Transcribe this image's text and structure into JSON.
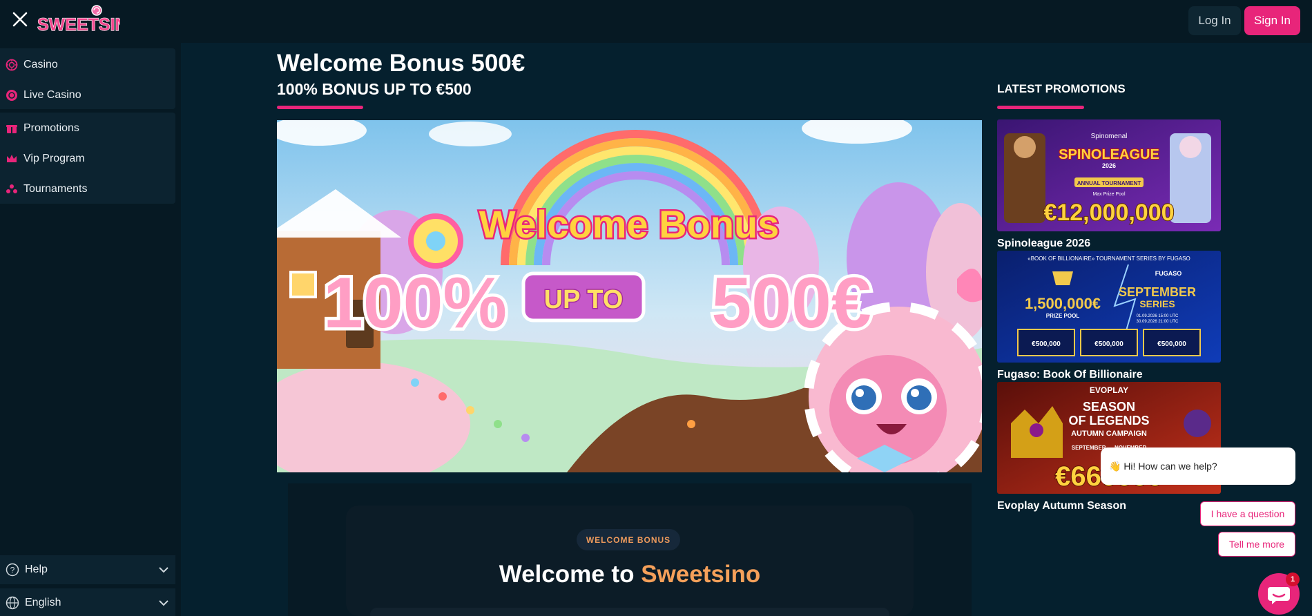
{
  "header": {
    "logo_text": "SWEETSINO",
    "login_label": "Log In",
    "signin_label": "Sign In"
  },
  "sidebar": {
    "items": [
      {
        "label": "Casino",
        "icon": "casino-chip-icon"
      },
      {
        "label": "Live Casino",
        "icon": "live-casino-icon"
      },
      {
        "label": "Promotions",
        "icon": "gift-icon"
      },
      {
        "label": "Vip Program",
        "icon": "crown-icon"
      },
      {
        "label": "Tournaments",
        "icon": "tournament-icon"
      }
    ],
    "help_label": "Help",
    "language_label": "English"
  },
  "main": {
    "title": "Welcome Bonus 500€",
    "subtitle": "100% BONUS UP TO €500",
    "banner": {
      "headline": "Welcome Bonus",
      "percent": "100%",
      "upto": "UP TO",
      "amount": "500€"
    },
    "card": {
      "badge": "WELCOME BONUS",
      "heading_prefix": "Welcome to",
      "heading_brand": "Sweetsino"
    }
  },
  "promotions": {
    "heading": "LATEST PROMOTIONS",
    "items": [
      {
        "name": "Spinoleague 2026",
        "img_brand": "Spinomenal",
        "img_title": "SPINOLEAGUE",
        "img_year": "2026",
        "img_sub": "ANNUAL TOURNAMENT",
        "img_note": "Max Prize Pool",
        "img_amount": "€12,000,000"
      },
      {
        "name": "Fugaso: Book Of Billionaire",
        "img_top": "«BOOK OF BILLIONAIRE» TOURNAMENT SERIES BY FUGASO",
        "img_brand": "FUGASO",
        "img_pool": "1,500,000€",
        "img_pool_label": "PRIZE POOL",
        "img_series": "SEPTEMBER",
        "img_series2": "SERIES",
        "img_dates1": "01.09.2026 15:00 UTC",
        "img_dates2": "30.09.2026 21:00 UTC",
        "img_prize": "€500,000"
      },
      {
        "name": "Evoplay Autumn Season",
        "img_brand": "EVOPLAY",
        "img_line1": "SEASON",
        "img_line2": "OF LEGENDS",
        "img_line3": "AUTUMN CAMPAIGN",
        "img_line4": "SEPTEMBER — NOVEMBER",
        "img_amount": "€660000"
      }
    ]
  },
  "chat": {
    "greeting": "👋 Hi! How can we help?",
    "options": [
      "I have a question",
      "Tell me more"
    ],
    "unread": "1"
  },
  "colors": {
    "accent": "#e8257a",
    "background": "#05202e",
    "panel": "#061923",
    "brand_orange": "#f5a05a"
  }
}
